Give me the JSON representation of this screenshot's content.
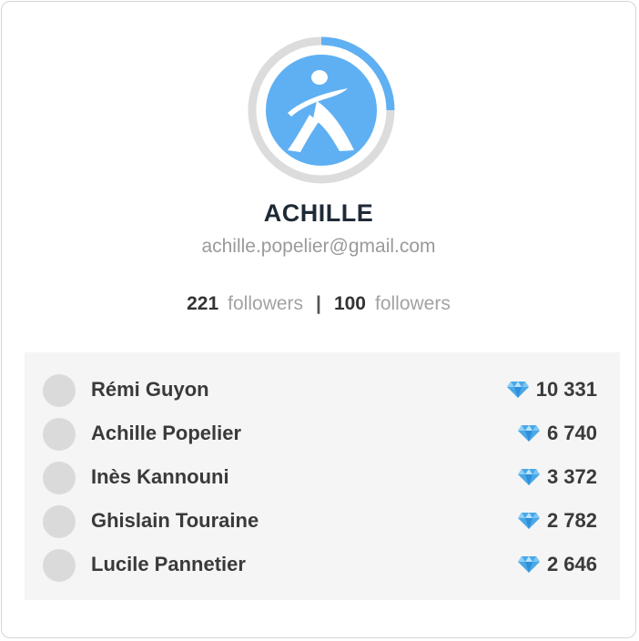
{
  "profile": {
    "name": "ACHILLE",
    "email": "achille.popelier@gmail.com",
    "progress": 0.25,
    "colors": {
      "accent": "#5fb0f3",
      "ring_track": "#dcdcdc"
    },
    "avatar_icon": "walking-person-logo-icon"
  },
  "stats": {
    "first_count": "221",
    "first_label": "followers",
    "separator": "|",
    "second_count": "100",
    "second_label": "followers"
  },
  "leaderboard": {
    "score_icon": "diamond-icon",
    "rows": [
      {
        "name": "Rémi Guyon",
        "score": "10 331"
      },
      {
        "name": "Achille Popelier",
        "score": "6 740"
      },
      {
        "name": "Inès Kannouni",
        "score": "3 372"
      },
      {
        "name": "Ghislain Touraine",
        "score": "2 782"
      },
      {
        "name": "Lucile Pannetier",
        "score": "2 646"
      }
    ]
  }
}
